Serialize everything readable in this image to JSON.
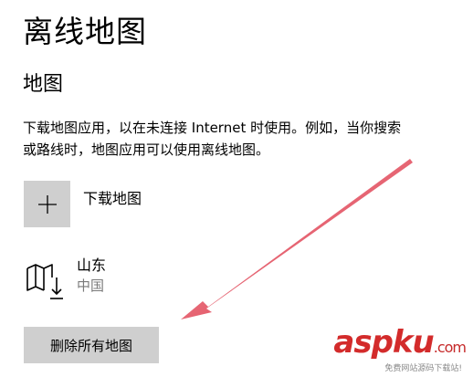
{
  "header": {
    "title": "离线地图"
  },
  "maps_section": {
    "title": "地图",
    "description_lines": [
      "下载地图应用，以在未连接 Internet 时使用。例如，当你搜索",
      "或路线时，地图应用可以使用离线地图。"
    ]
  },
  "download": {
    "label": "下载地图",
    "icon": "plus-icon"
  },
  "downloaded_map": {
    "name": "山东",
    "region": "中国",
    "icon": "map-download-icon"
  },
  "delete_button": {
    "label": "删除所有地图"
  },
  "annotation": {
    "color": "#e0394a"
  },
  "watermark": {
    "brand": "aspku",
    "domain": ".com",
    "tagline": "免费网站源码下载站!"
  }
}
